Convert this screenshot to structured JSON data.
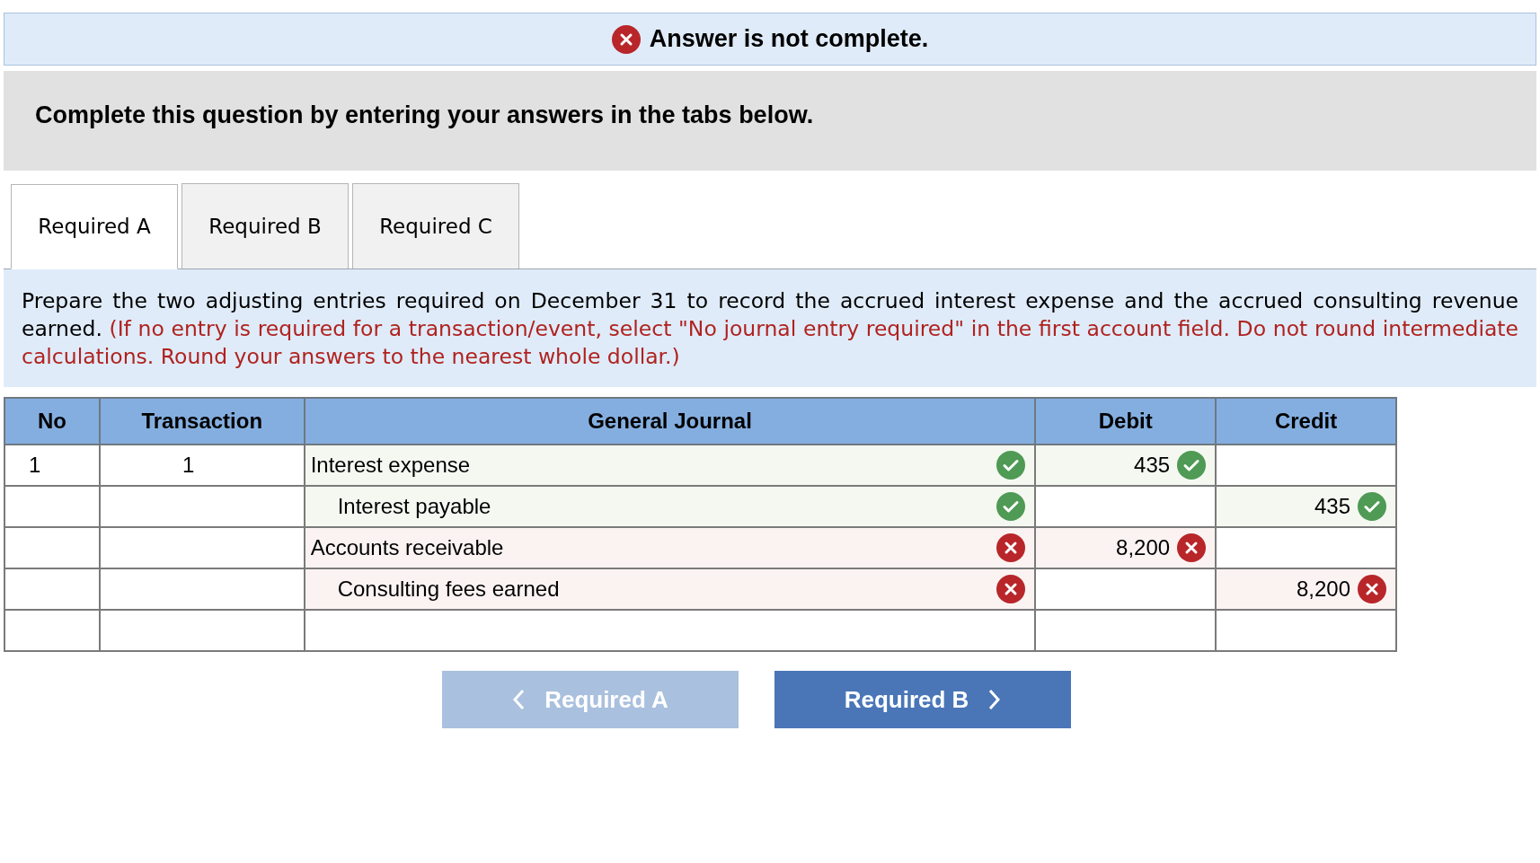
{
  "banner": {
    "correct": false,
    "message": "Answer is not complete."
  },
  "heading": "Complete this question by entering your answers in the tabs below.",
  "tabs": [
    {
      "label": "Required A",
      "selected": true
    },
    {
      "label": "Required B",
      "selected": false
    },
    {
      "label": "Required C",
      "selected": false
    }
  ],
  "instructions": {
    "text": "Prepare the two adjusting entries required on December 31 to record the accrued interest expense and the accrued consulting revenue earned.",
    "note": "(If no entry is required for a transaction/event, select \"No journal entry required\" in the first account field. Do not round intermediate calculations. Round your answers to the nearest whole dollar.)"
  },
  "table": {
    "columns": [
      "No",
      "Transaction",
      "General Journal",
      "Debit",
      "Credit"
    ],
    "rows": [
      {
        "no": "1",
        "transaction": "1",
        "account": "Interest expense",
        "indented": false,
        "account_correct": true,
        "debit": "435",
        "debit_correct": true
      },
      {
        "account": "Interest payable",
        "indented": true,
        "account_correct": true,
        "credit": "435",
        "credit_correct": true
      },
      {
        "account": "Accounts receivable",
        "indented": false,
        "account_correct": false,
        "debit": "8,200",
        "debit_correct": false
      },
      {
        "account": "Consulting fees earned",
        "indented": true,
        "account_correct": false,
        "credit": "8,200",
        "credit_correct": false
      },
      {}
    ]
  },
  "buttons": [
    {
      "label": "Required A",
      "kind": "previous",
      "disabled": true
    },
    {
      "label": "Required B",
      "kind": "next",
      "disabled": false
    }
  ]
}
